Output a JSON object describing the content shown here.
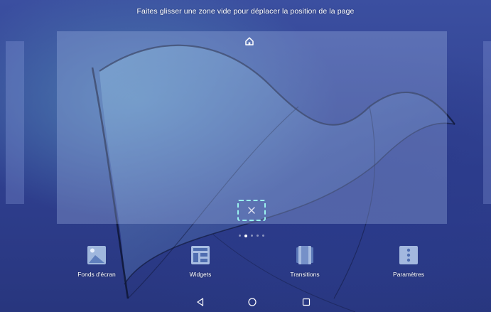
{
  "instruction": "Faites glisser une zone vide pour déplacer la position de la page",
  "menu": [
    {
      "label": "Fonds d'écran",
      "icon": "wallpaper-icon"
    },
    {
      "label": "Widgets",
      "icon": "widgets-icon"
    },
    {
      "label": "Transitions",
      "icon": "transitions-icon"
    },
    {
      "label": "Paramètres",
      "icon": "settings-icon"
    }
  ],
  "pages": {
    "count": 5,
    "current_index": 1
  },
  "colors": {
    "add_page_outline": "#9af2ee",
    "text": "#ffffff",
    "background": "#2e3e86"
  },
  "navigation": [
    "back-icon",
    "home-icon",
    "recents-icon"
  ]
}
